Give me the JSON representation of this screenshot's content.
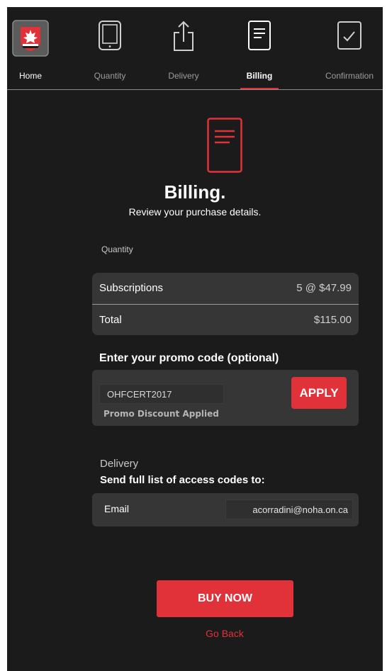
{
  "nav": {
    "items": [
      {
        "label": "Home",
        "icon": "hockey-canada-logo"
      },
      {
        "label": "Quantity",
        "icon": "tablet-icon"
      },
      {
        "label": "Delivery",
        "icon": "share-upload-icon"
      },
      {
        "label": "Billing",
        "icon": "document-icon"
      },
      {
        "label": "Confirmation",
        "icon": "checkbox-icon"
      }
    ],
    "active": "Billing"
  },
  "hero": {
    "icon": "document-icon",
    "title": "Billing.",
    "subtitle": "Review your purchase details."
  },
  "summary": {
    "section_label": "Quantity",
    "rows": [
      {
        "label": "Subscriptions",
        "value": "5 @ $47.99"
      },
      {
        "label": "Total",
        "value": "$115.00"
      }
    ]
  },
  "promo": {
    "heading": "Enter your promo code (optional)",
    "code": "OHFCERT2017",
    "apply_label": "APPLY",
    "status": "Promo Discount Applied"
  },
  "delivery": {
    "label": "Delivery",
    "sub": "Send full list of access codes to:",
    "email_label": "Email",
    "email_value": "acorradini@noha.on.ca"
  },
  "actions": {
    "buy_label": "BUY NOW",
    "back_label": "Go Back"
  },
  "colors": {
    "background": "#1b1b1b",
    "card": "#363636",
    "accent": "#e1323a",
    "muted_text": "#9d9d9d"
  }
}
